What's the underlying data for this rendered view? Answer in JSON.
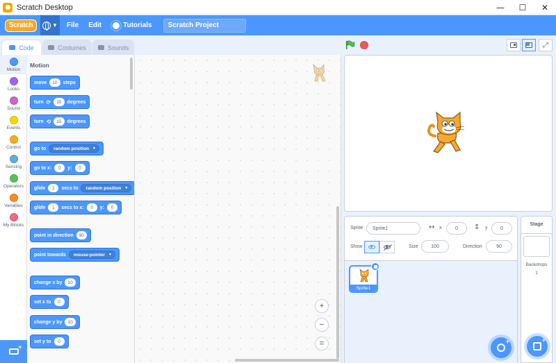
{
  "window": {
    "title": "Scratch Desktop",
    "controls": {
      "minimize": "—",
      "maximize": "☐",
      "close": "✕"
    }
  },
  "menubar": {
    "logo": "Scratch",
    "language_icon": "globe-icon",
    "items": [
      {
        "label": "File"
      },
      {
        "label": "Edit"
      },
      {
        "label": "Tutorials"
      }
    ],
    "project_title": "Scratch Project"
  },
  "tabs": [
    {
      "label": "Code",
      "active": true
    },
    {
      "label": "Costumes",
      "active": false
    },
    {
      "label": "Sounds",
      "active": false
    }
  ],
  "categories": [
    {
      "label": "Motion",
      "color": "#4c97ff",
      "active": true
    },
    {
      "label": "Looks",
      "color": "#9966ff"
    },
    {
      "label": "Sound",
      "color": "#cf63cf"
    },
    {
      "label": "Events",
      "color": "#ffd500"
    },
    {
      "label": "Control",
      "color": "#ffab19"
    },
    {
      "label": "Sensing",
      "color": "#5cb1d6"
    },
    {
      "label": "Operators",
      "color": "#59c059"
    },
    {
      "label": "Variables",
      "color": "#ff8c1a"
    },
    {
      "label": "My Blocks",
      "color": "#ff6680"
    }
  ],
  "palette": {
    "heading": "Motion",
    "blocks": {
      "move": {
        "a": "move",
        "v": "10",
        "b": "steps"
      },
      "turn_right": {
        "a": "turn",
        "icon": "⟳",
        "v": "15",
        "b": "degrees"
      },
      "turn_left": {
        "a": "turn",
        "icon": "⟲",
        "v": "15",
        "b": "degrees"
      },
      "goto": {
        "a": "go to",
        "dd": "random position"
      },
      "goto_xy": {
        "a": "go to x:",
        "x": "0",
        "b": "y:",
        "y": "0"
      },
      "glide_to": {
        "a": "glide",
        "v": "1",
        "b": "secs to",
        "dd": "random position"
      },
      "glide_xy": {
        "a": "glide",
        "v": "1",
        "b": "secs to x:",
        "x": "0",
        "c": "y:",
        "y": "0"
      },
      "point_dir": {
        "a": "point in direction",
        "v": "90"
      },
      "point_towards": {
        "a": "point towards",
        "dd": "mouse-pointer"
      },
      "change_x": {
        "a": "change x by",
        "v": "10"
      },
      "set_x": {
        "a": "set x to",
        "v": "0"
      },
      "change_y": {
        "a": "change y by",
        "v": "10"
      },
      "set_y": {
        "a": "set y to",
        "v": "0"
      }
    }
  },
  "zoom": {
    "in": "+",
    "out": "−",
    "reset": "="
  },
  "sprite": {
    "label": "Sprite",
    "name": "Sprite1",
    "x_label": "x",
    "x": "0",
    "y_label": "y",
    "y": "0",
    "show_label": "Show",
    "size_label": "Size",
    "size": "100",
    "direction_label": "Direction",
    "direction": "90"
  },
  "sprite_list": [
    {
      "name": "Sprite1",
      "selected": true
    }
  ],
  "stage_panel": {
    "title": "Stage",
    "backdrops_label": "Backdrops",
    "backdrops_count": "1"
  }
}
